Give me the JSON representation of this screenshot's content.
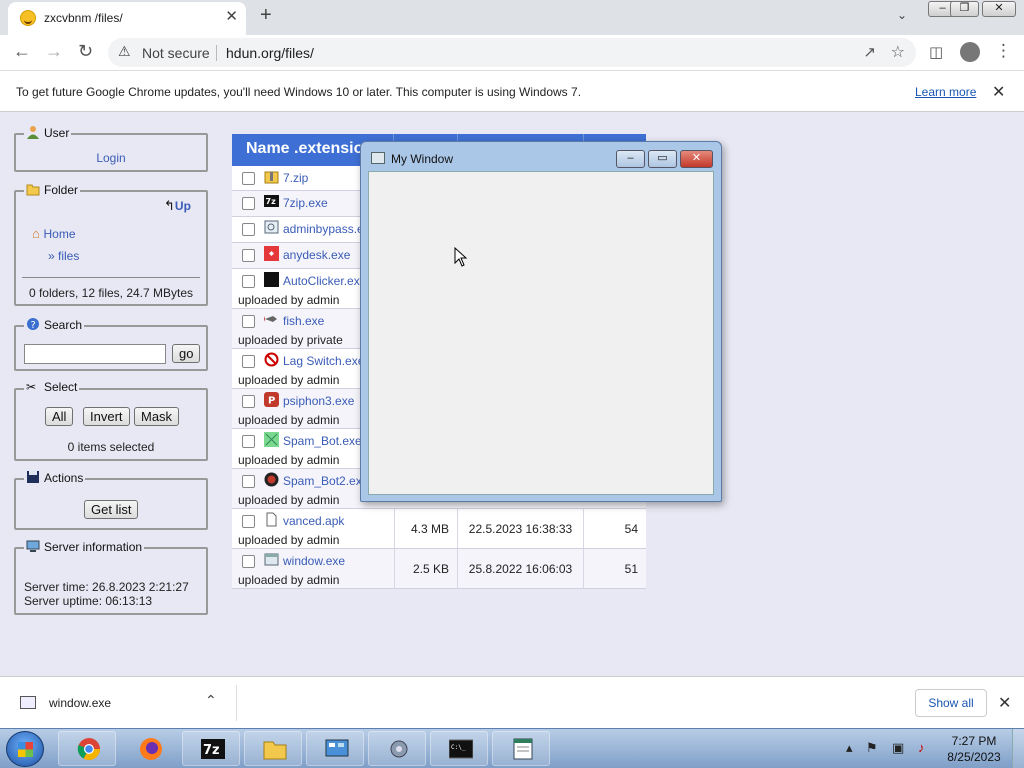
{
  "browser": {
    "tab_title": "zxcvbnm /files/",
    "tab_close": "✕",
    "new_tab": "+",
    "security_label": "Not secure",
    "url": "hdun.org/files/",
    "window_buttons": [
      "–",
      "❐",
      "✕"
    ]
  },
  "infobar": {
    "message": "To get future Google Chrome updates, you'll need Windows 10 or later. This computer is using Windows 7.",
    "learn_more": "Learn more",
    "close": "✕"
  },
  "sidebar": {
    "user": {
      "legend": "User",
      "login": "Login"
    },
    "folder": {
      "legend": "Folder",
      "up": "Up",
      "home": "Home",
      "current": "» files",
      "summary": "0 folders, 12 files, 24.7 MBytes"
    },
    "search": {
      "legend": "Search",
      "value": "",
      "go": "go"
    },
    "select": {
      "legend": "Select",
      "all": "All",
      "invert": "Invert",
      "mask": "Mask",
      "status": "0 items selected"
    },
    "actions": {
      "legend": "Actions",
      "get_list": "Get list"
    },
    "server": {
      "legend": "Server information",
      "time": "Server time: 26.8.2023 2:21:27",
      "uptime": "Server uptime: 06:13:13"
    }
  },
  "table": {
    "header_name": "Name .extension",
    "rows": [
      {
        "name": "7.zip",
        "icon": "zip-folder-icon",
        "uploader": "",
        "size": "",
        "date": "",
        "hits": ""
      },
      {
        "name": "7zip.exe",
        "icon": "7zip-icon",
        "uploader": "",
        "size": "",
        "date": "",
        "hits": ""
      },
      {
        "name": "adminbypass.exe",
        "icon": "app-icon",
        "uploader": "",
        "size": "",
        "date": "",
        "hits": ""
      },
      {
        "name": "anydesk.exe",
        "icon": "anydesk-icon",
        "uploader": "",
        "size": "",
        "date": "",
        "hits": ""
      },
      {
        "name": "AutoClicker.exe",
        "icon": "autoclicker-icon",
        "uploader": "uploaded by admin",
        "size": "",
        "date": "",
        "hits": ""
      },
      {
        "name": "fish.exe",
        "icon": "fish-icon",
        "uploader": "uploaded by private",
        "size": "",
        "date": "",
        "hits": ""
      },
      {
        "name": "Lag Switch.exe",
        "icon": "no-sign-icon",
        "uploader": "uploaded by admin",
        "size": "",
        "date": "",
        "hits": ""
      },
      {
        "name": "psiphon3.exe",
        "icon": "psiphon-icon",
        "uploader": "uploaded by admin",
        "size": "",
        "date": "",
        "hits": ""
      },
      {
        "name": "Spam_Bot.exe",
        "icon": "spambot-icon",
        "uploader": "uploaded by admin",
        "size": "",
        "date": "",
        "hits": ""
      },
      {
        "name": "Spam_Bot2.exe",
        "icon": "spambot2-icon",
        "uploader": "uploaded by admin",
        "size": "",
        "date": "",
        "hits": ""
      },
      {
        "name": "vanced.apk",
        "icon": "file-icon",
        "uploader": "uploaded by admin",
        "size": "4.3 MB",
        "date": "22.5.2023 16:38:33",
        "hits": "54"
      },
      {
        "name": "window.exe",
        "icon": "window-app-icon",
        "uploader": "uploaded by admin",
        "size": "2.5 KB",
        "date": "25.8.2022 16:06:03",
        "hits": "51"
      }
    ]
  },
  "overlay_window": {
    "title": "My Window",
    "buttons": [
      "–",
      "▭",
      "✕"
    ]
  },
  "download_bar": {
    "file": "window.exe",
    "show_all": "Show all",
    "close": "✕"
  },
  "taskbar": {
    "time": "7:27 PM",
    "date": "8/25/2023",
    "apps": [
      "chrome-icon",
      "firefox-icon",
      "7zip-icon",
      "explorer-icon",
      "control-panel-icon",
      "settings-icon",
      "cmd-icon",
      "notepad-icon"
    ]
  }
}
